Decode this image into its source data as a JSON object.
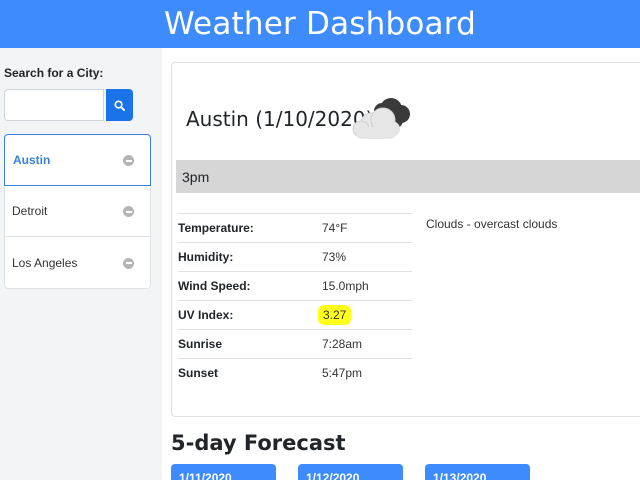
{
  "header": {
    "title": "Weather Dashboard"
  },
  "sidebar": {
    "search_label": "Search for a City:",
    "search_value": "",
    "search_placeholder": "",
    "cities": [
      {
        "name": "Austin",
        "active": true
      },
      {
        "name": "Detroit",
        "active": false
      },
      {
        "name": "Los Angeles",
        "active": false
      }
    ]
  },
  "current": {
    "title": "Austin (1/10/2020)",
    "icon": "clouds-icon",
    "hour": "3pm",
    "description": "Clouds - overcast clouds",
    "details": [
      {
        "label": "Temperature:",
        "value": "74°F"
      },
      {
        "label": "Humidity:",
        "value": "73%"
      },
      {
        "label": "Wind Speed:",
        "value": "15.0mph"
      },
      {
        "label": "UV Index:",
        "value": "3.27",
        "highlight": true
      },
      {
        "label": "Sunrise",
        "value": "7:28am"
      },
      {
        "label": "Sunset",
        "value": "5:47pm"
      }
    ]
  },
  "forecast": {
    "title": "5-day Forecast",
    "days": [
      "1/11/2020",
      "1/12/2020",
      "1/13/2020"
    ]
  },
  "colors": {
    "header": "#3d8bfd",
    "search_button": "#1a73e8",
    "active_city": "#3b82d6",
    "uv_highlight": "#ffff1a",
    "hour_bar": "#d6d6d6"
  }
}
